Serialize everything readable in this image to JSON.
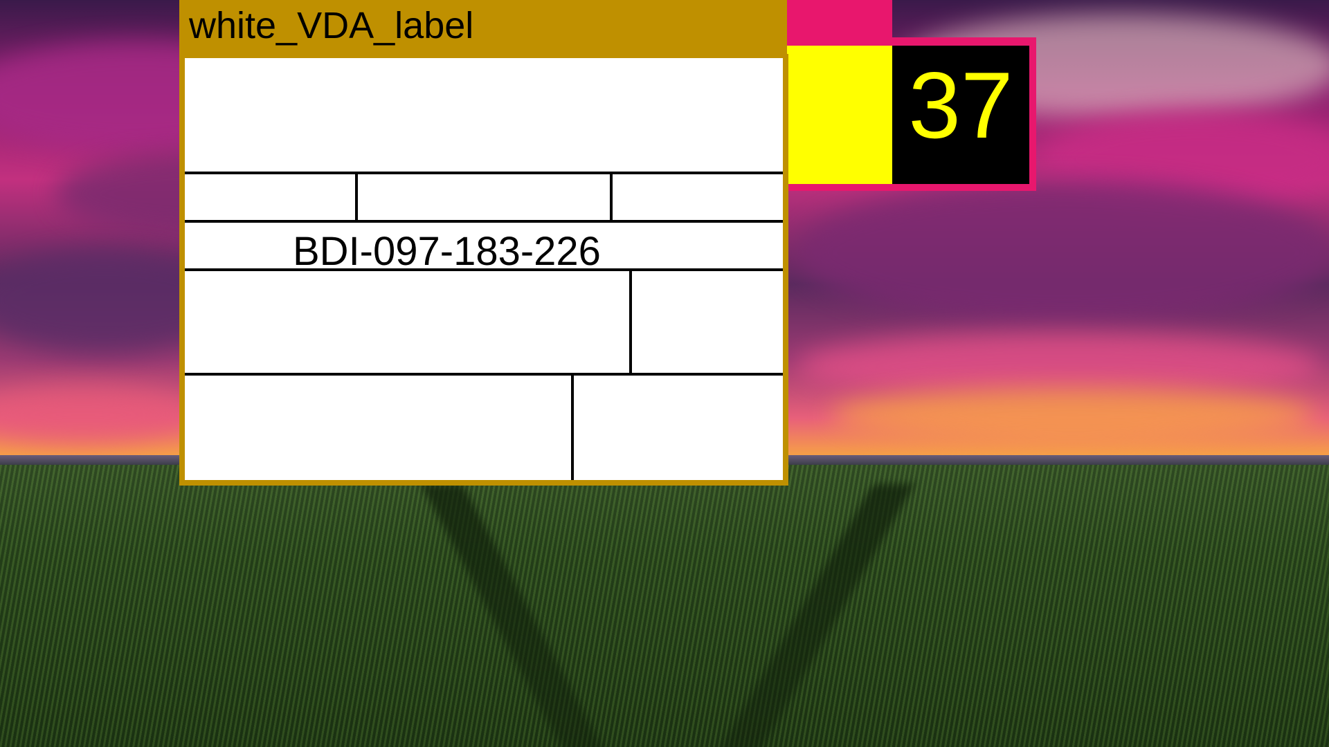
{
  "label_window": {
    "title": "white_VDA_label",
    "code": "BDI-097-183-226"
  },
  "badge": {
    "value": "37"
  },
  "colors": {
    "label_frame": "#bf9000",
    "label_sheet": "#ffffff",
    "badge_border": "#e8176d",
    "badge_fill": "#ffff00",
    "badge_number_bg": "#000000",
    "badge_number_text": "#ffff00"
  }
}
